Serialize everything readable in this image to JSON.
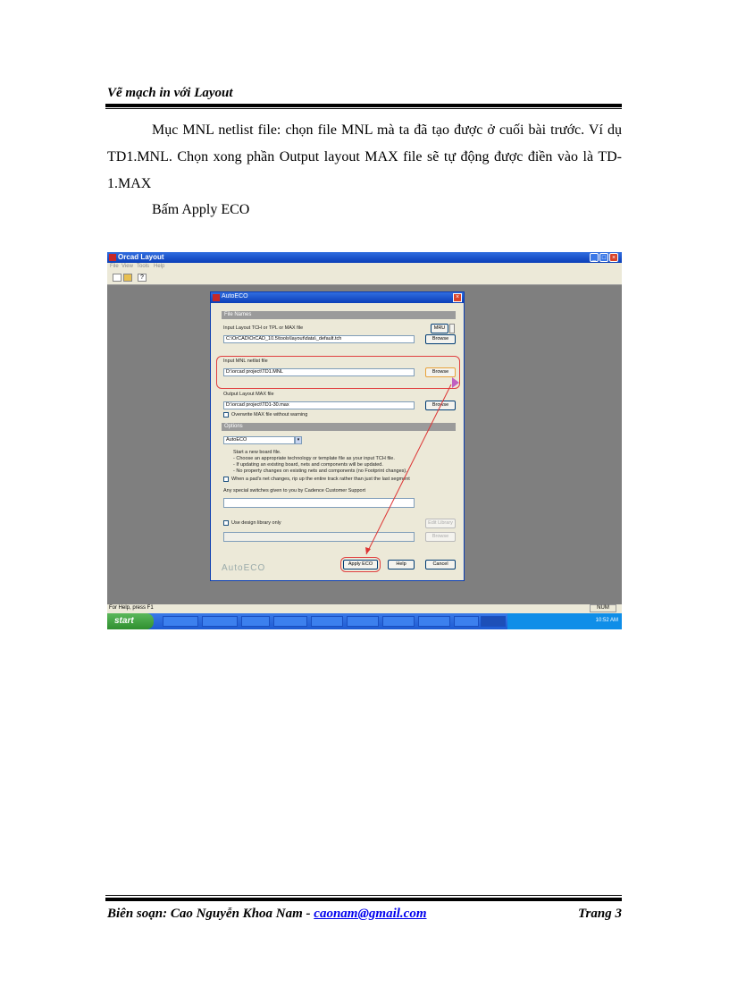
{
  "header": {
    "title": "Vẽ mạch in với Layout"
  },
  "body": {
    "paragraph1": "Mục MNL netlist file: chọn file MNL mà ta đã tạo được ở cuối bài trước. Ví dụ TD1.MNL. Chọn xong phần Output layout MAX file sẽ tự động được điền vào là TD-1.MAX",
    "paragraph2": "Bấm Apply ECO"
  },
  "screenshot": {
    "window_title": "Orcad Layout",
    "menu": [
      "File",
      "View",
      "Tools",
      "Help"
    ],
    "status_text": "For Help, press F1",
    "status_num": "NUM",
    "taskbar": {
      "start": "start",
      "clock": "10:52 AM"
    },
    "dialog": {
      "title": "AutoECO",
      "section_file_names": "File Names",
      "input_layout_label": "Input Layout TCH or TPL or MAX file",
      "input_layout_value": "C:\\OrCAD\\OrCAD_10.5\\tools\\layout\\data\\_default.tch",
      "mru_label": "MRU",
      "browse_label": "Browse",
      "input_mnl_label": "Input MNL netlist file",
      "input_mnl_value": "D:\\orcad project\\TD1.MNL",
      "output_max_label": "Output Layout MAX file",
      "output_max_value": "D:\\orcad project\\TD1-30.max",
      "overwrite_label": "Overwrite MAX file without warning",
      "section_options": "Options",
      "mode_value": "AutoECO",
      "desc_lines": [
        "Start a new board file.",
        "- Choose an appropriate technology or template file as your input TCH file.",
        "- If updating an existing board, nets and components will be updated.",
        "- No property changes on existing nets and components (no Footprint changes)."
      ],
      "rip_label": "When a pad's net changes, rip up the entire track rather than just the last segment",
      "switches_label": "Any special switches given to you by Cadence Customer Support",
      "design_library_label": "Use design library only",
      "edit_library_label": "Edit Library",
      "logo": "AutoECO",
      "apply_label": "Apply ECO",
      "help_label": "Help",
      "cancel_label": "Cancel"
    }
  },
  "footer": {
    "author": "Biên soạn: Cao Nguyễn Khoa Nam - ",
    "email": "caonam@gmail.com",
    "page": "Trang 3"
  }
}
